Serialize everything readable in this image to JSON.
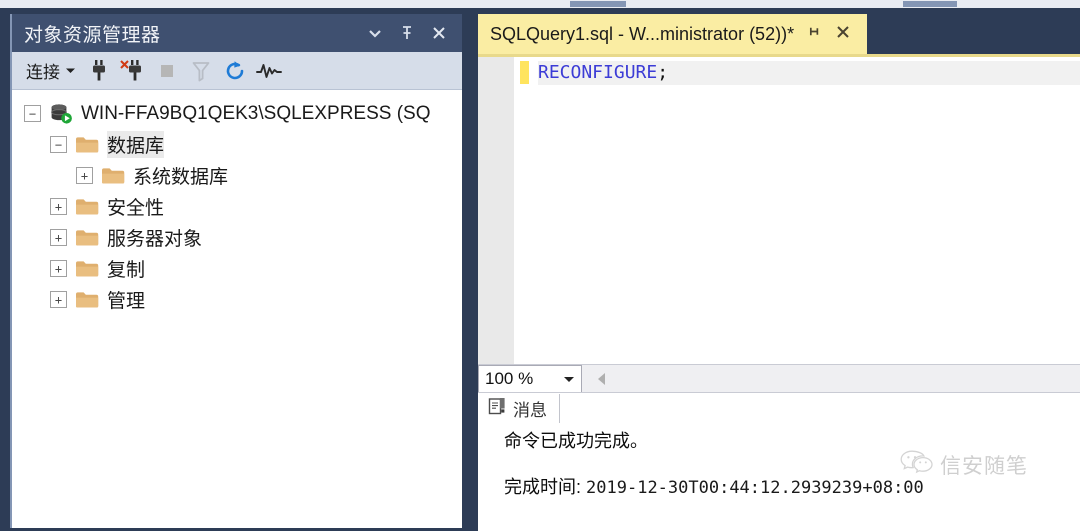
{
  "object_explorer": {
    "title": "对象资源管理器",
    "title_buttons": [
      {
        "name": "window-menu-chevron-icon",
        "label": "▾"
      },
      {
        "name": "auto-hide-pin-icon",
        "label": "⇱"
      },
      {
        "name": "close-icon",
        "label": "✕"
      }
    ],
    "toolbar": {
      "connect_label": "连接",
      "connect_caret": "▾",
      "icons": [
        {
          "name": "connect-plug-icon",
          "title": "连接"
        },
        {
          "name": "disconnect-plug-icon",
          "title": "断开连接"
        },
        {
          "name": "stop-icon",
          "title": "停止"
        },
        {
          "name": "filter-funnel-icon",
          "title": "筛选器"
        },
        {
          "name": "refresh-icon",
          "title": "刷新"
        },
        {
          "name": "activity-monitor-icon",
          "title": "活动监视器"
        }
      ]
    },
    "tree": [
      {
        "label": "WIN-FFA9BQ1QEK3\\SQLEXPRESS (SQ",
        "icon": "server-database-running-icon",
        "depth": 0,
        "expander": "−",
        "selected": false
      },
      {
        "label": "数据库",
        "icon": "folder-icon",
        "depth": 1,
        "expander": "−",
        "selected": true
      },
      {
        "label": "系统数据库",
        "icon": "folder-icon",
        "depth": 2,
        "expander": "+",
        "selected": false
      },
      {
        "label": "安全性",
        "icon": "folder-icon",
        "depth": 1,
        "expander": "+",
        "selected": false
      },
      {
        "label": "服务器对象",
        "icon": "folder-icon",
        "depth": 1,
        "expander": "+",
        "selected": false
      },
      {
        "label": "复制",
        "icon": "folder-icon",
        "depth": 1,
        "expander": "+",
        "selected": false
      },
      {
        "label": "管理",
        "icon": "folder-icon",
        "depth": 1,
        "expander": "+",
        "selected": false
      }
    ]
  },
  "document": {
    "tab": {
      "label": "SQLQuery1.sql - W...ministrator (52))*",
      "pin_icon": "pin-icon",
      "close_icon": "close-icon"
    },
    "editor": {
      "code_keyword": "RECONFIGURE",
      "code_punct": ";"
    }
  },
  "results": {
    "zoom": {
      "value": "100 %",
      "caret": "▾"
    },
    "tab": {
      "label": "消息",
      "icon": "messages-report-icon"
    },
    "messages": {
      "line1": "命令已成功完成。",
      "line2_label": "完成时间:",
      "line2_value": "2019-12-30T00:44:12.2939239+08:00"
    }
  },
  "watermark": {
    "text": "信安随笔",
    "icon": "wechat-logo-icon"
  },
  "colors": {
    "chrome_navy": "#2D3C56",
    "title_navy": "#3F5070",
    "toolbar_blue_gray": "#D6DDE9",
    "tab_yellow": "#FAEDA3",
    "change_bar_yellow": "#FFE45E",
    "keyword_blue": "#3C3CD6",
    "folder_tan": "#E3B977",
    "refresh_blue": "#1E7BD6",
    "running_green": "#22A03A"
  }
}
